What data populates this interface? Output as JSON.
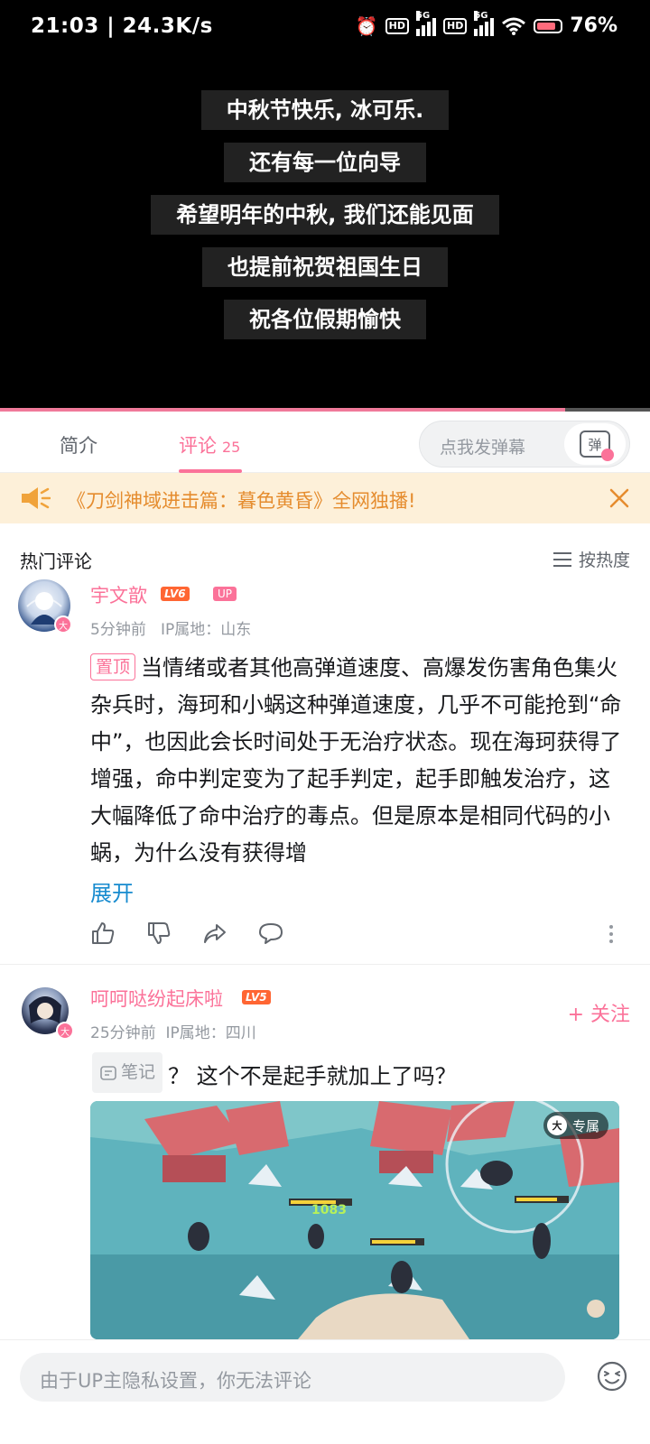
{
  "status_bar": {
    "time": "21:03 | 24.3K/s",
    "net_badge": "HD",
    "net_gen": "5G",
    "battery": "76%"
  },
  "video": {
    "captions": [
      "中秋节快乐, 冰可乐.",
      "还有每一位向导",
      "希望明年的中秋, 我们还能见面",
      "也提前祝贺祖国生日",
      "祝各位假期愉快"
    ]
  },
  "tabs": {
    "intro": "简介",
    "comments": "评论",
    "comments_count": "25",
    "danmaku_placeholder": "点我发弹幕",
    "danmaku_btn": "弹"
  },
  "banner": {
    "text": "《刀剑神域进击篇：暮色黄昏》全网独播!"
  },
  "comments_header": {
    "title": "热门评论",
    "sort": "按热度"
  },
  "comments": [
    {
      "username": "宇文歆",
      "level": "LV6",
      "up_tag": "UP",
      "avatar_badge": "大",
      "time": "5分钟前",
      "ip": "IP属地：山东",
      "pinned_label": "置顶",
      "text": "当情绪或者其他高弹道速度、高爆发伤害角色集火杂兵时，海珂和小蜗这种弹道速度，几乎不可能抢到“命中”，也因此会长时间处于无治疗状态。现在海珂获得了增强，命中判定变为了起手判定，起手即触发治疗，这大幅降低了命中治疗的毒点。但是原本是相同代码的小蜗，为什么没有获得增",
      "expand": "展开"
    },
    {
      "username": "呵呵哒纷起床啦",
      "level": "LV5",
      "avatar_badge": "大",
      "time": "25分钟前",
      "ip": "IP属地：四川",
      "follow": "+ 关注",
      "note_chip": "笔记",
      "text": "？ 这个不是起手就加上了吗？",
      "image_badge_icon": "大",
      "image_badge": "专属",
      "image_number": "1083"
    }
  ],
  "bottom_bar": {
    "placeholder": "由于UP主隐私设置，你无法评论"
  },
  "colors": {
    "accent": "#fb7299",
    "link": "#178bcf",
    "banner_bg": "#fdf0d9",
    "banner_text": "#e58c2e"
  }
}
